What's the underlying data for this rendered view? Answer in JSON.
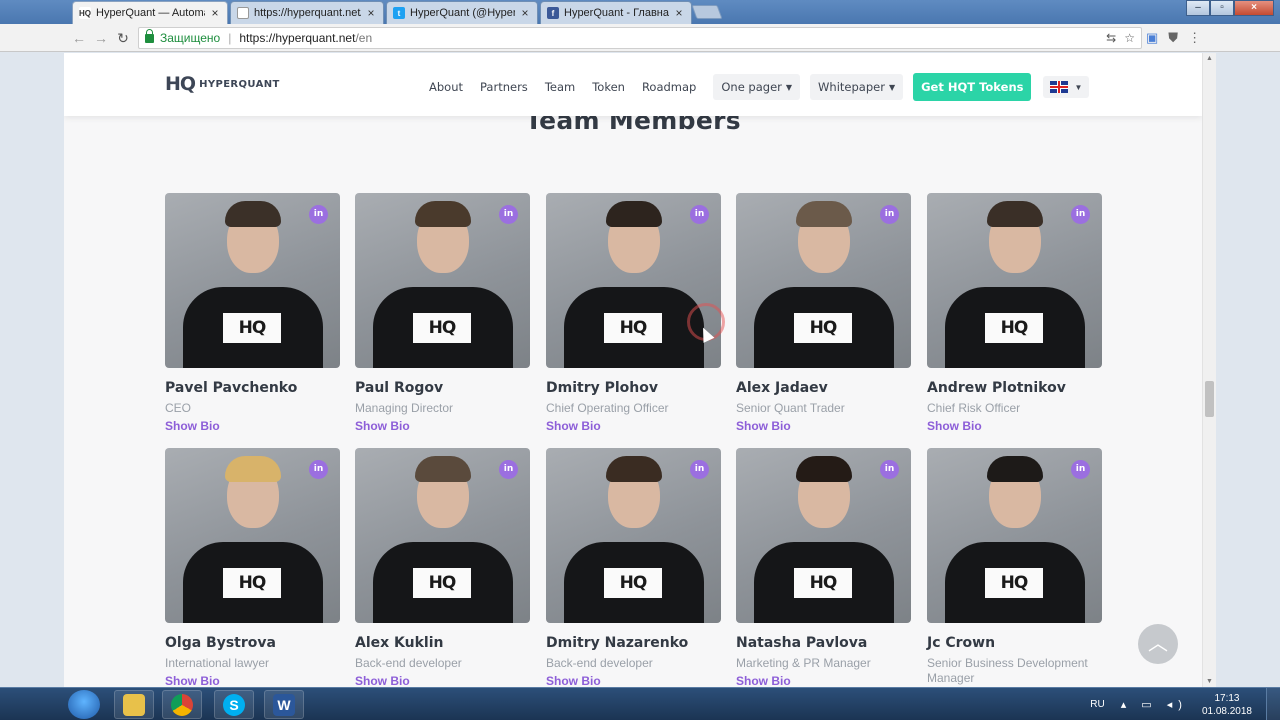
{
  "browser": {
    "tabs": [
      {
        "title": "HyperQuant — Automatio",
        "favicon": "hq-favicon",
        "active": true
      },
      {
        "title": "https://hyperquant.net/e",
        "favicon": "page-favicon",
        "active": false
      },
      {
        "title": "HyperQuant (@HyperQu",
        "favicon": "twitter-favicon",
        "active": false
      },
      {
        "title": "HyperQuant - Главная | (",
        "favicon": "facebook-favicon",
        "active": false
      }
    ],
    "secure_label": "Защищено",
    "url_host": "https://hyperquant.net",
    "url_path": "/en"
  },
  "site": {
    "logo_mark": "HQ",
    "logo_text": "HYPERQUANT",
    "nav": {
      "about": "About",
      "partners": "Partners",
      "team": "Team",
      "token": "Token",
      "roadmap": "Roadmap",
      "one_pager": "One pager",
      "whitepaper": "Whitepaper",
      "cta": "Get HQT Tokens"
    },
    "section_title": "Team Members",
    "show_bio_label": "Show Bio",
    "linkedin_label": "in",
    "shirt_mark": "HQ",
    "colors": {
      "accent": "#8d5ed8",
      "cta": "#2bd4a7",
      "logo_red": "#e23c3c"
    }
  },
  "team": [
    {
      "name": "Pavel Pavchenko",
      "role": "CEO"
    },
    {
      "name": "Paul Rogov",
      "role": "Managing Director"
    },
    {
      "name": "Dmitry Plohov",
      "role": "Chief Operating Officer"
    },
    {
      "name": "Alex Jadaev",
      "role": "Senior Quant Trader"
    },
    {
      "name": "Andrew Plotnikov",
      "role": "Chief Risk Officer"
    },
    {
      "name": "Olga Bystrova",
      "role": "International lawyer"
    },
    {
      "name": "Alex Kuklin",
      "role": "Back-end developer"
    },
    {
      "name": "Dmitry Nazarenko",
      "role": "Back-end developer"
    },
    {
      "name": "Natasha Pavlova",
      "role": "Marketing & PR Manager"
    },
    {
      "name": "Jc Crown",
      "role": "Senior Business Development Manager"
    }
  ],
  "taskbar": {
    "apps": [
      {
        "name": "explorer",
        "icon": "folder-icon"
      },
      {
        "name": "chrome",
        "icon": "chrome-icon"
      },
      {
        "name": "skype",
        "icon": "skype-icon"
      },
      {
        "name": "word",
        "icon": "word-icon"
      }
    ],
    "lang": "RU",
    "time": "17:13",
    "date": "01.08.2018"
  }
}
